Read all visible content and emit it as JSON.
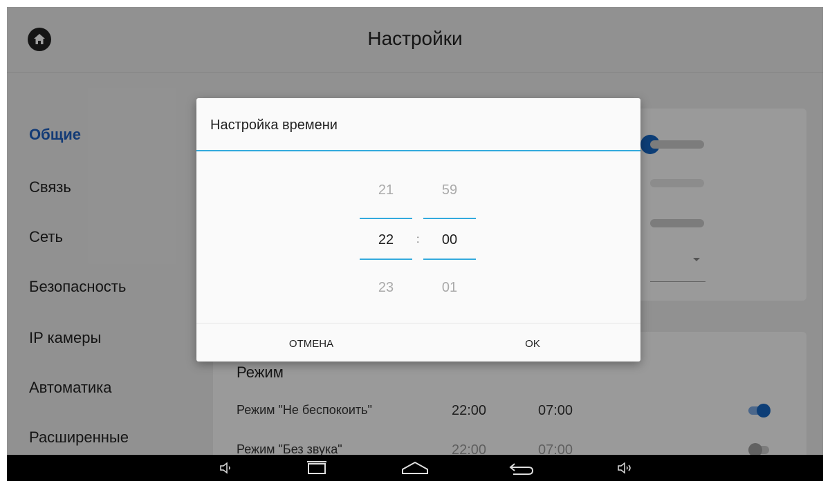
{
  "header": {
    "title": "Настройки"
  },
  "sidebar": {
    "items": [
      {
        "label": "Общие",
        "active": true
      },
      {
        "label": "Связь"
      },
      {
        "label": "Сеть"
      },
      {
        "label": "Безопасность"
      },
      {
        "label": "IP камеры"
      },
      {
        "label": "Автоматика"
      },
      {
        "label": "Расширенные"
      }
    ]
  },
  "mode_card": {
    "title": "Режим",
    "rows": [
      {
        "label": "Режим \"Не беспокоить\"",
        "start": "22:00",
        "end": "07:00",
        "enabled": true
      },
      {
        "label": "Режим \"Без звука\"",
        "start": "22:00",
        "end": "07:00",
        "enabled": false
      }
    ]
  },
  "dialog": {
    "title": "Настройка времени",
    "hours": {
      "prev": "21",
      "current": "22",
      "next": "23"
    },
    "minutes": {
      "prev": "59",
      "current": "00",
      "next": "01"
    },
    "separator": ":",
    "cancel_label": "ОТМЕНА",
    "ok_label": "OK"
  },
  "colors": {
    "accent": "#33aadd",
    "active_sidebar": "#1f5fbf",
    "toggle_on": "#1565c0"
  },
  "icons": {
    "home": "home-icon",
    "nav": [
      "volume-down-icon",
      "recent-apps-icon",
      "home-nav-icon",
      "back-icon",
      "volume-up-icon"
    ]
  }
}
